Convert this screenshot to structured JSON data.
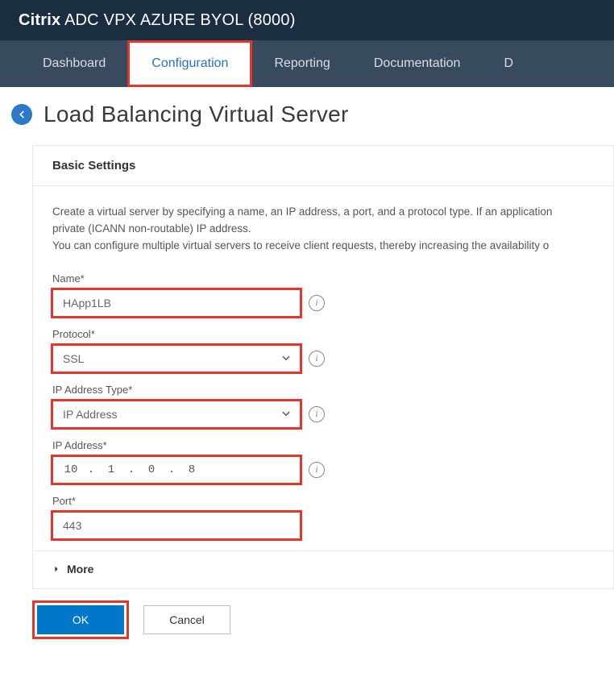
{
  "header": {
    "brand": "Citrix",
    "product": "ADC VPX AZURE BYOL (8000)"
  },
  "nav": {
    "items": [
      "Dashboard",
      "Configuration",
      "Reporting",
      "Documentation",
      "D"
    ],
    "active_index": 1
  },
  "page": {
    "title": "Load Balancing Virtual Server"
  },
  "panel": {
    "title": "Basic Settings",
    "desc_line1": "Create a virtual server by specifying a name, an IP address, a port, and a protocol type. If an application",
    "desc_line2": "private (ICANN non-routable) IP address.",
    "desc_line3": "You can configure multiple virtual servers to receive client requests, thereby increasing the availability o"
  },
  "form": {
    "name_label": "Name*",
    "name_value": "HApp1LB",
    "protocol_label": "Protocol*",
    "protocol_value": "SSL",
    "iptype_label": "IP Address Type*",
    "iptype_value": "IP Address",
    "ipaddr_label": "IP Address*",
    "ip": {
      "a": "10",
      "b": "1",
      "c": "0",
      "d": "8"
    },
    "port_label": "Port*",
    "port_value": "443",
    "more_label": "More"
  },
  "buttons": {
    "ok": "OK",
    "cancel": "Cancel"
  }
}
